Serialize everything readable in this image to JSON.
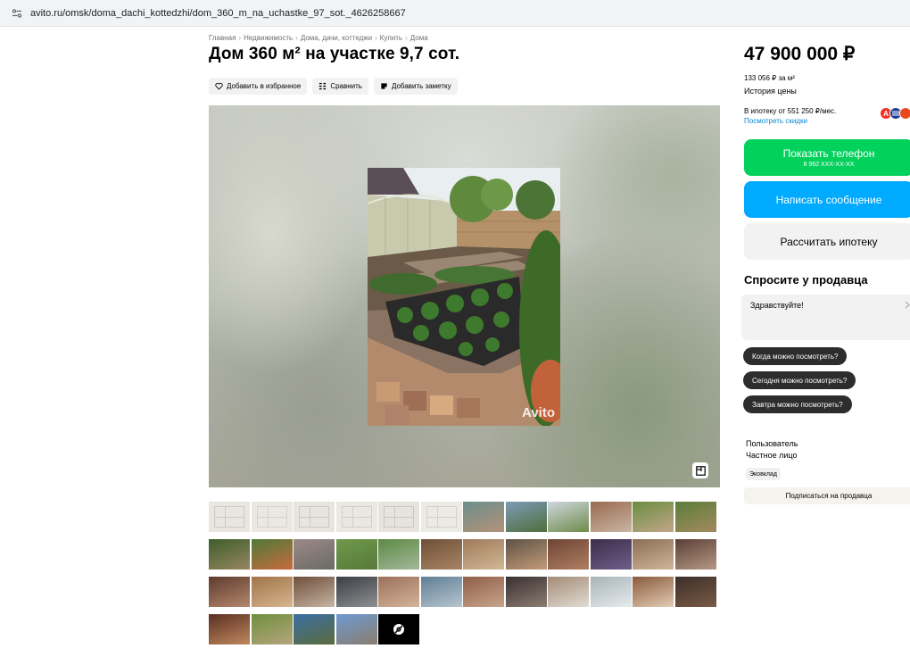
{
  "browser": {
    "url": "avito.ru/omsk/doma_dachi_kottedzhi/dom_360_m_na_uchastke_97_sot._4626258667"
  },
  "breadcrumb": [
    "Главная",
    "Недвижимость",
    "Дома, дачи, коттеджи",
    "Купить",
    "Дома"
  ],
  "breadcrumb_sep": "›",
  "listing": {
    "title": "Дом 360 м² на участке 9,7 сот.",
    "actions": {
      "favorite": "Добавить в избранное",
      "compare": "Сравнить",
      "note": "Добавить заметку"
    },
    "watermark": "Avito",
    "thumbnail_count": 46
  },
  "sidebar": {
    "price": "47 900 000 ₽",
    "price_per_m": "133 056 ₽ за м²",
    "price_history": "История цены",
    "mortgage": "В ипотеку от 551 250 ₽/мес.",
    "discounts": "Посмотреть скидки",
    "banks": [
      {
        "letter": "А",
        "color": "#ef3124"
      },
      {
        "letter": "B",
        "color": "#1f3a93"
      },
      {
        "letter": "",
        "color": "#e94b1c"
      }
    ],
    "phone_button": "Показать телефон",
    "phone_masked": "8 962 XXX-XX-XX",
    "message_button": "Написать сообщение",
    "mortgage_button": "Рассчитать ипотеку",
    "ask_title": "Спросите у продавца",
    "ask_placeholder": "Здравствуйте!",
    "quick_questions": [
      "Когда можно посмотреть?",
      "Сегодня можно посмотреть?",
      "Завтра можно посмотреть?"
    ],
    "seller_name": "Пользователь",
    "seller_type": "Частное лицо",
    "badge": "Эковклад",
    "subscribe": "Подписаться на продавца"
  },
  "colors": {
    "green": "#02d15c",
    "blue": "#00aaff",
    "link": "#0a88d4"
  }
}
